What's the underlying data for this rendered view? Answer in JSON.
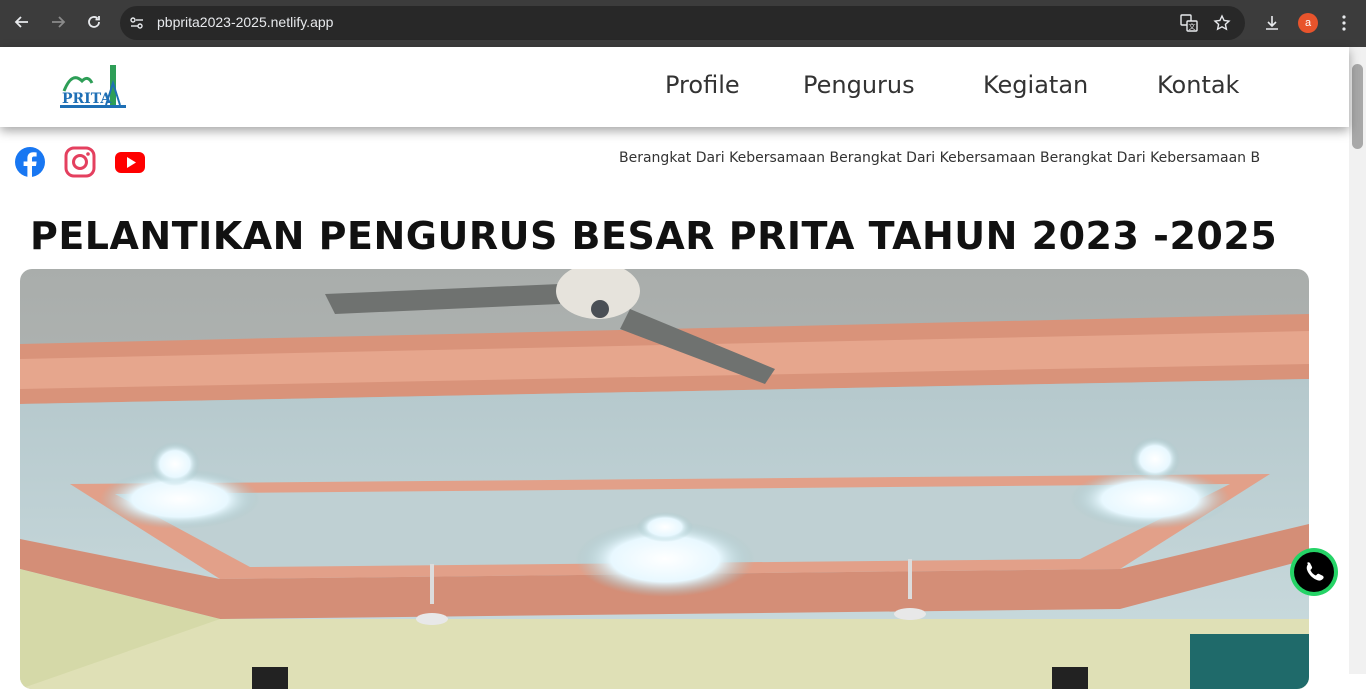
{
  "browser": {
    "url": "pbprita2023-2025.netlify.app",
    "profile_initial": "a"
  },
  "header": {
    "logo_text": "PRITA",
    "nav": [
      {
        "label": "Profile"
      },
      {
        "label": "Pengurus"
      },
      {
        "label": "Kegiatan"
      },
      {
        "label": "Kontak"
      }
    ]
  },
  "social": {
    "icons": [
      "facebook-icon",
      "instagram-icon",
      "youtube-icon"
    ]
  },
  "marquee": {
    "text": "Berangkat Dari Kebersamaan Berangkat Dari Kebersamaan Berangkat Dari Kebersamaan B"
  },
  "main": {
    "title": "PELANTIKAN PENGURUS BESAR PRITA TAHUN 2023 -2025"
  },
  "colors": {
    "chrome_bg": "#3c3c3c",
    "omnibox_bg": "#282828",
    "facebook": "#1877f2",
    "instagram": "#e4405f",
    "youtube": "#ff0000",
    "whatsapp": "#25d366",
    "logo_blue": "#1e6fb5",
    "logo_green": "#2e9e57"
  }
}
